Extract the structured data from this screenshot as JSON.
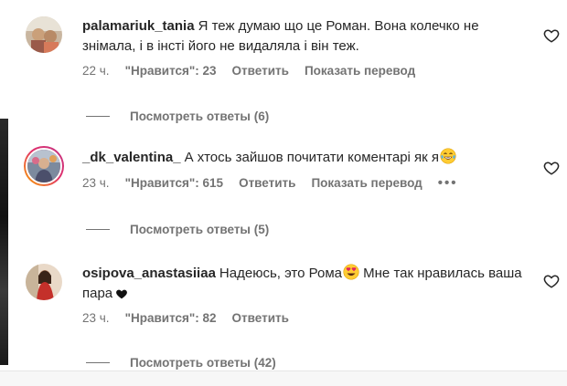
{
  "comments": [
    {
      "username": "palamariuk_tania",
      "text": "Я теж думаю що це Роман. Вона колечко не знімала, і в інсті його не видаляла і він теж.",
      "time": "22 ч.",
      "likes_label": "\"Нравится\": 23",
      "reply_label": "Ответить",
      "translate_label": "Показать перевод",
      "replies_label": "Посмотреть ответы (6)"
    },
    {
      "username": "_dk_valentina_",
      "text": "А хтось зайшов почитати коментарі як я",
      "emoji": "laughing-tears",
      "time": "23 ч.",
      "likes_label": "\"Нравится\": 615",
      "reply_label": "Ответить",
      "translate_label": "Показать перевод",
      "more_label": "•••",
      "replies_label": "Посмотреть ответы (5)"
    },
    {
      "username": "osipova_anastasiiaa",
      "text_part1": "Надеюсь, это Рома",
      "emoji": "heart-eyes",
      "text_part2": " Мне так нравилась ваша пара",
      "heart": "black-heart",
      "time": "23 ч.",
      "likes_label": "\"Нравится\": 82",
      "reply_label": "Ответить",
      "replies_label": "Посмотреть ответы (42)"
    }
  ],
  "colors": {
    "text": "#262626",
    "secondary": "#737373",
    "story_ring_start": "#f9a400",
    "story_ring_end": "#c13584"
  }
}
